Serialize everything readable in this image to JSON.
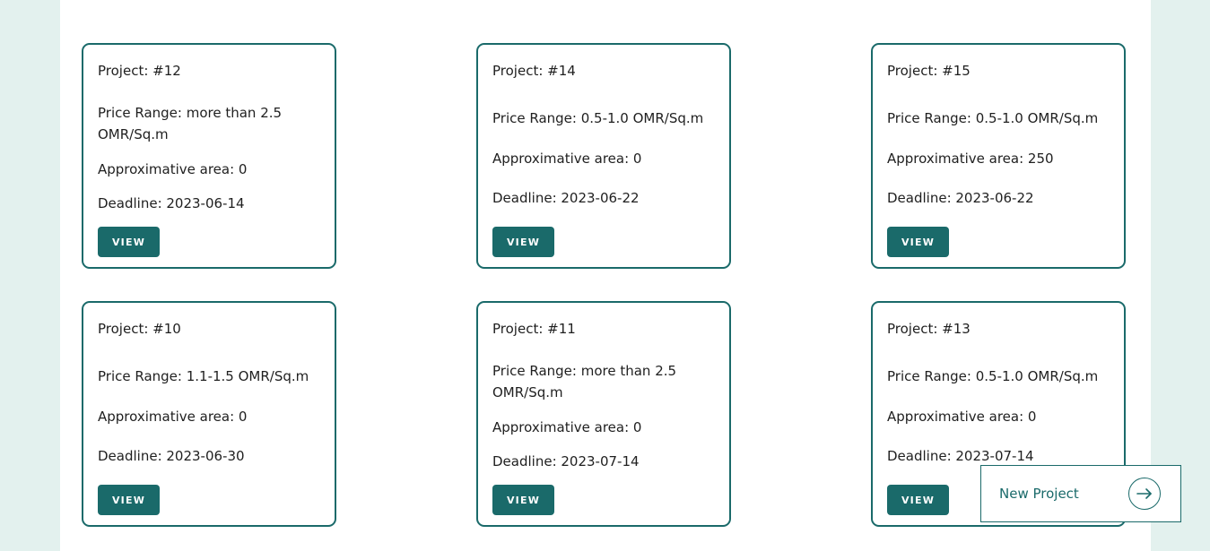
{
  "projects": [
    {
      "title": "Project: #12",
      "price_range": "Price Range: more than 2.5 OMR/Sq.m",
      "area": "Approximative area: 0",
      "deadline": "Deadline: 2023-06-14",
      "button": "VIEW"
    },
    {
      "title": "Project: #14",
      "price_range": "Price Range: 0.5-1.0 OMR/Sq.m",
      "area": "Approximative area: 0",
      "deadline": "Deadline: 2023-06-22",
      "button": "VIEW"
    },
    {
      "title": "Project: #15",
      "price_range": "Price Range: 0.5-1.0 OMR/Sq.m",
      "area": "Approximative area: 250",
      "deadline": "Deadline: 2023-06-22",
      "button": "VIEW"
    },
    {
      "title": "Project: #10",
      "price_range": "Price Range: 1.1-1.5 OMR/Sq.m",
      "area": "Approximative area: 0",
      "deadline": "Deadline: 2023-06-30",
      "button": "VIEW"
    },
    {
      "title": "Project: #11",
      "price_range": "Price Range: more than 2.5 OMR/Sq.m",
      "area": "Approximative area: 0",
      "deadline": "Deadline: 2023-07-14",
      "button": "VIEW"
    },
    {
      "title": "Project: #13",
      "price_range": "Price Range: 0.5-1.0 OMR/Sq.m",
      "area": "Approximative area: 0",
      "deadline": "Deadline: 2023-07-14",
      "button": "VIEW"
    }
  ],
  "new_project": {
    "label": "New Project",
    "icon": "arrow-right-icon"
  },
  "colors": {
    "accent": "#1a6a6a",
    "page_background": "#e3f1ee",
    "panel_background": "#ffffff"
  }
}
